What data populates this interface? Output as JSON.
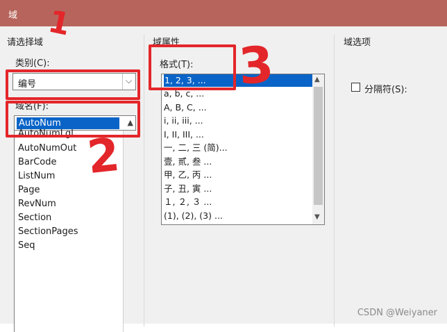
{
  "window": {
    "title": "域"
  },
  "left_panel": {
    "group_title": "请选择域",
    "category_label": "类别(C):",
    "category_value": "编号",
    "fieldname_label": "域名(F):",
    "fieldname_selected": "AutoNum",
    "fieldname_items": [
      "AutoNumLgl",
      "AutoNumOut",
      "BarCode",
      "ListNum",
      "Page",
      "RevNum",
      "Section",
      "SectionPages",
      "Seq"
    ]
  },
  "middle_panel": {
    "group_title": "域属性",
    "format_label": "格式(T):",
    "formats": [
      "1, 2, 3, ...",
      "a, b, c, ...",
      "A, B, C, ...",
      "i, ii, iii, ...",
      "I, II, III, ...",
      "一, 二, 三 (简)...",
      "壹, 贰, 叁 ...",
      "甲, 乙, 丙 ...",
      "子, 丑, 寅 ...",
      "１, ２, ３ ...",
      "(1), (2), (3) ..."
    ],
    "selected_format_index": 0
  },
  "right_panel": {
    "group_title": "域选项",
    "separator_label": "分隔符(S):",
    "separator_checked": false
  },
  "annotations": {
    "a1": "1",
    "a2": "2",
    "a3": "3"
  },
  "watermark": "CSDN @Weiyaner",
  "colors": {
    "titlebar": "#b7655c",
    "selection": "#0a64c8",
    "annotation": "#e3262a"
  }
}
